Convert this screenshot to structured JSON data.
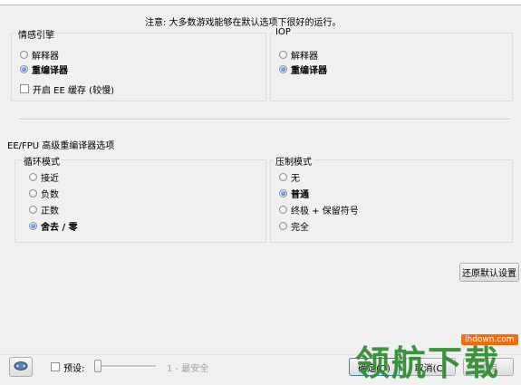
{
  "notice": "注意: 大多数游戏能够在默认选项下很好的运行。",
  "ee_group": {
    "title": "情感引擎",
    "options": [
      "解释器",
      "重编译器"
    ],
    "selected": 1,
    "cache_label": "开启 EE 缓存 (较慢)"
  },
  "iop_group": {
    "title": "IOP",
    "options": [
      "解释器",
      "重编译器"
    ],
    "selected": 1
  },
  "fpu_section": {
    "title": "EE/FPU 高级重编译器选项",
    "rounding": {
      "title": "循环模式",
      "options": [
        "接近",
        "负数",
        "正数",
        "舍去 / 零"
      ],
      "selected": 3
    },
    "clamping": {
      "title": "压制模式",
      "options": [
        "无",
        "普通",
        "终极 + 保留符号",
        "完全"
      ],
      "selected": 1
    }
  },
  "restore_defaults": "还原默认设置",
  "bottom": {
    "preset_label": "预设:",
    "preset_value": "1 - 最安全",
    "preset_level": 1,
    "ok": "确定(O)",
    "cancel": "取消(C)",
    "apply": "应用"
  },
  "watermark": {
    "site": "lhdown.com",
    "text": "领航下载"
  }
}
